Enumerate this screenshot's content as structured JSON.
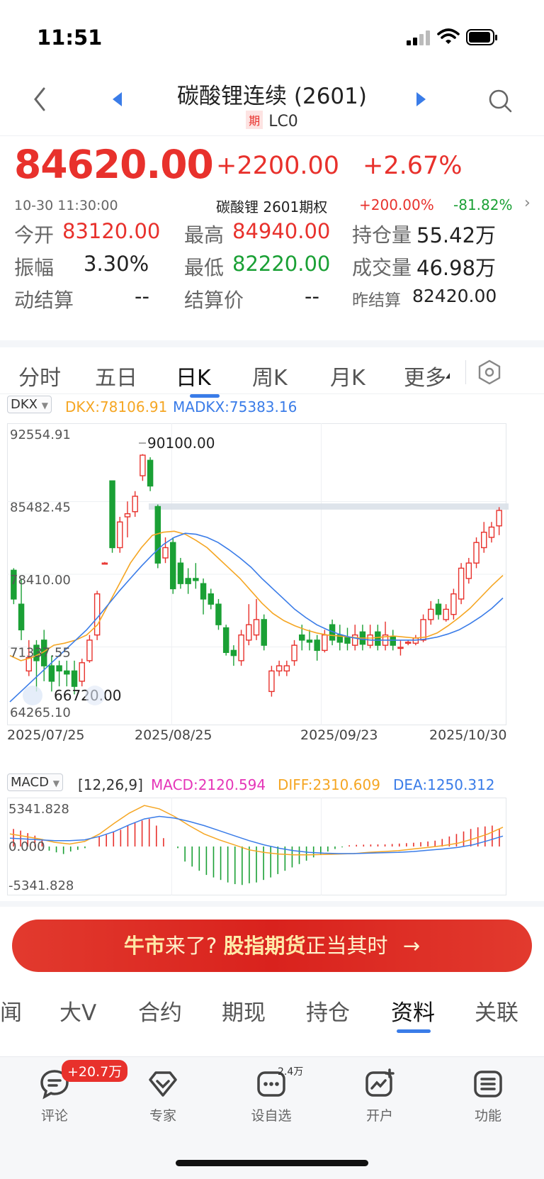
{
  "status_bar": {
    "time": "11:51"
  },
  "header": {
    "title": "碳酸锂连续 (2601)",
    "tag": "期",
    "code": "LC0"
  },
  "quote": {
    "price": "84620.00",
    "change": "+2200.00",
    "change_pct": "+2.67%",
    "timestamp": "10-30 11:30:00",
    "option_name": "碳酸锂 2601期权",
    "option_pct1": "+200.00%",
    "option_pct2": "-81.82%"
  },
  "stats": [
    {
      "label": "今开",
      "value": "83120.00",
      "color": "red"
    },
    {
      "label": "最高",
      "value": "84940.00",
      "color": "red"
    },
    {
      "label": "持仓量",
      "value": "55.42万",
      "color": "dark"
    },
    {
      "label": "振幅",
      "value": "3.30%",
      "color": "dark"
    },
    {
      "label": "最低",
      "value": "82220.00",
      "color": "green"
    },
    {
      "label": "成交量",
      "value": "46.98万",
      "color": "dark"
    },
    {
      "label": "动结算",
      "value": "--",
      "color": "dark"
    },
    {
      "label": "结算价",
      "value": "--",
      "color": "dark"
    },
    {
      "label": "昨结算",
      "value": "82420.00",
      "color": "dark"
    }
  ],
  "kline_tabs": [
    "分时",
    "五日",
    "日K",
    "周K",
    "月K",
    "更多"
  ],
  "kline_active": 2,
  "indicator": {
    "name": "DKX",
    "dkx": "DKX:78106.91",
    "madkx": "MADKX:75383.16"
  },
  "macd": {
    "name": "MACD",
    "params": "[12,26,9]",
    "macd": "MACD:2120.594",
    "diff": "DIFF:2310.609",
    "dea": "DEA:1250.312"
  },
  "colors": {
    "up": "#e8312c",
    "down": "#1aa035",
    "dkx": "#f5a623",
    "madkx": "#3a7ce8",
    "macd": "#e535b8",
    "accent": "#3a7ce8"
  },
  "chart_data": [
    {
      "type": "candlestick",
      "y_ticks": [
        "92554.91",
        "85482.45",
        "78410.00",
        "71337.55",
        "64265.10"
      ],
      "ylim": [
        64265.1,
        92554.91
      ],
      "x_labels": [
        "2025/07/25",
        "2025/08/25",
        "2025/09/23",
        "2025/10/30"
      ],
      "annotations": {
        "max_label": "90100.00",
        "min_label": "66720.00"
      },
      "series": [
        {
          "name": "DKX",
          "values": [
            70500,
            70000,
            70300,
            70800,
            71500,
            71700,
            72000,
            72500,
            73500,
            75500,
            77500,
            79500,
            81000,
            82200,
            82500,
            82600,
            82300,
            81700,
            81000,
            80000,
            79000,
            78000,
            76800,
            75600,
            74600,
            73900,
            73400,
            73000,
            72700,
            72500,
            72400,
            72300,
            72200,
            72200,
            72300,
            72400,
            72300,
            72200,
            72300,
            72700,
            73400,
            74200,
            75100,
            76200,
            77300,
            78300
          ]
        },
        {
          "name": "MADKX",
          "values": [
            66000,
            67000,
            68000,
            69000,
            70000,
            71000,
            72000,
            73000,
            74200,
            75500,
            76800,
            78000,
            79200,
            80300,
            81300,
            82000,
            82400,
            82300,
            82000,
            81500,
            80800,
            80000,
            79100,
            78000,
            77000,
            76000,
            75000,
            74200,
            73500,
            73000,
            72600,
            72300,
            72100,
            72000,
            72000,
            72000,
            72000,
            72000,
            72100,
            72300,
            72600,
            73000,
            73600,
            74300,
            75100,
            76100
          ]
        }
      ],
      "candles": [
        {
          "o": 78800,
          "c": 76000,
          "h": 79000,
          "l": 75500
        },
        {
          "o": 75500,
          "c": 73000,
          "h": 78000,
          "l": 72000
        },
        {
          "o": 69000,
          "c": 70300,
          "h": 72000,
          "l": 68500
        },
        {
          "o": 71500,
          "c": 70000,
          "h": 72000,
          "l": 67000
        },
        {
          "o": 72000,
          "c": 69500,
          "h": 73000,
          "l": 68000
        },
        {
          "o": 69500,
          "c": 68000,
          "h": 70500,
          "l": 67000
        },
        {
          "o": 69500,
          "c": 69000,
          "h": 70000,
          "l": 67500
        },
        {
          "o": 69000,
          "c": 68700,
          "h": 70000,
          "l": 67500
        },
        {
          "o": 69000,
          "c": 67500,
          "h": 70000,
          "l": 66720
        },
        {
          "o": 68000,
          "c": 69800,
          "h": 70200,
          "l": 67500
        },
        {
          "o": 70000,
          "c": 72000,
          "h": 72500,
          "l": 69800
        },
        {
          "o": 72500,
          "c": 76500,
          "h": 76800,
          "l": 72000
        },
        {
          "o": 79500,
          "c": 79500,
          "h": 79600,
          "l": 79400
        },
        {
          "o": 87500,
          "c": 81000,
          "h": 87500,
          "l": 80500
        },
        {
          "o": 81000,
          "c": 83500,
          "h": 84000,
          "l": 80500
        },
        {
          "o": 84000,
          "c": 84300,
          "h": 85500,
          "l": 82000
        },
        {
          "o": 84500,
          "c": 86000,
          "h": 86500,
          "l": 84000
        },
        {
          "o": 88000,
          "c": 90000,
          "h": 90100,
          "l": 87500
        },
        {
          "o": 89500,
          "c": 87000,
          "h": 89800,
          "l": 86500
        },
        {
          "o": 85000,
          "c": 79500,
          "h": 85200,
          "l": 79000
        },
        {
          "o": 80000,
          "c": 81000,
          "h": 82000,
          "l": 79500
        },
        {
          "o": 81500,
          "c": 77000,
          "h": 82000,
          "l": 76500
        },
        {
          "o": 79500,
          "c": 77500,
          "h": 80000,
          "l": 77000
        },
        {
          "o": 78000,
          "c": 77500,
          "h": 79000,
          "l": 76500
        },
        {
          "o": 78000,
          "c": 77800,
          "h": 79500,
          "l": 77000
        },
        {
          "o": 77500,
          "c": 76000,
          "h": 78000,
          "l": 74500
        },
        {
          "o": 76500,
          "c": 75500,
          "h": 77000,
          "l": 75000
        },
        {
          "o": 75500,
          "c": 73500,
          "h": 76000,
          "l": 73000
        },
        {
          "o": 73200,
          "c": 70800,
          "h": 73500,
          "l": 70500
        },
        {
          "o": 71000,
          "c": 70500,
          "h": 71500,
          "l": 69500
        },
        {
          "o": 70000,
          "c": 72500,
          "h": 73000,
          "l": 69500
        },
        {
          "o": 72000,
          "c": 73500,
          "h": 75500,
          "l": 71500
        },
        {
          "o": 72500,
          "c": 74000,
          "h": 76000,
          "l": 72000
        },
        {
          "o": 74000,
          "c": 71500,
          "h": 74500,
          "l": 71000
        },
        {
          "o": 67000,
          "c": 69000,
          "h": 69500,
          "l": 66500
        },
        {
          "o": 69000,
          "c": 69500,
          "h": 70000,
          "l": 68500
        },
        {
          "o": 69000,
          "c": 69500,
          "h": 70000,
          "l": 68500
        },
        {
          "o": 70000,
          "c": 71500,
          "h": 72000,
          "l": 69500
        },
        {
          "o": 72500,
          "c": 72000,
          "h": 73500,
          "l": 71000
        },
        {
          "o": 72000,
          "c": 71800,
          "h": 73000,
          "l": 71000
        },
        {
          "o": 72000,
          "c": 71000,
          "h": 72500,
          "l": 70000
        },
        {
          "o": 71000,
          "c": 72500,
          "h": 73000,
          "l": 70800
        },
        {
          "o": 73500,
          "c": 72000,
          "h": 74000,
          "l": 71500
        },
        {
          "o": 72500,
          "c": 71800,
          "h": 73500,
          "l": 71000
        },
        {
          "o": 72300,
          "c": 71700,
          "h": 73200,
          "l": 71000
        },
        {
          "o": 71500,
          "c": 72500,
          "h": 73500,
          "l": 71000
        },
        {
          "o": 72800,
          "c": 71600,
          "h": 73500,
          "l": 71000
        },
        {
          "o": 71500,
          "c": 72500,
          "h": 73500,
          "l": 71200
        },
        {
          "o": 72800,
          "c": 71500,
          "h": 73500,
          "l": 71000
        },
        {
          "o": 71500,
          "c": 72500,
          "h": 73800,
          "l": 71000
        },
        {
          "o": 72300,
          "c": 71500,
          "h": 73000,
          "l": 71000
        },
        {
          "o": 71300,
          "c": 71300,
          "h": 72000,
          "l": 70500
        },
        {
          "o": 71800,
          "c": 71800,
          "h": 72000,
          "l": 71500
        },
        {
          "o": 71700,
          "c": 72200,
          "h": 72500,
          "l": 71500
        },
        {
          "o": 72000,
          "c": 74000,
          "h": 74500,
          "l": 71800
        },
        {
          "o": 74000,
          "c": 75000,
          "h": 75800,
          "l": 73500
        },
        {
          "o": 75500,
          "c": 74500,
          "h": 76000,
          "l": 74000
        },
        {
          "o": 74000,
          "c": 75000,
          "h": 75500,
          "l": 73800
        },
        {
          "o": 74500,
          "c": 76500,
          "h": 77000,
          "l": 74000
        },
        {
          "o": 76000,
          "c": 79000,
          "h": 79500,
          "l": 75500
        },
        {
          "o": 78000,
          "c": 79500,
          "h": 80000,
          "l": 77500
        },
        {
          "o": 79500,
          "c": 81500,
          "h": 82000,
          "l": 79000
        },
        {
          "o": 81000,
          "c": 82500,
          "h": 83500,
          "l": 80500
        },
        {
          "o": 82000,
          "c": 83000,
          "h": 83500,
          "l": 81500
        },
        {
          "o": 83120,
          "c": 84620,
          "h": 84940,
          "l": 82220
        }
      ],
      "highlight_band": [
        84700,
        85300
      ]
    },
    {
      "type": "bar",
      "name": "MACD",
      "y_ticks": [
        "5341.828",
        "0.000",
        "-5341.828"
      ],
      "ylim": [
        -5341.828,
        5341.828
      ],
      "values": [
        2100,
        1900,
        1600,
        1300,
        900,
        -500,
        -700,
        -900,
        -600,
        -400,
        -200,
        0,
        1200,
        1400,
        1700,
        2000,
        2500,
        2900,
        3100,
        3300,
        2500,
        1000,
        0,
        -200,
        -1800,
        -2400,
        -2900,
        -3400,
        -3700,
        -4000,
        -4300,
        -4500,
        -4600,
        -4400,
        -4300,
        -4000,
        -3700,
        -3300,
        -2900,
        -2500,
        -2100,
        -1700,
        -1300,
        -900,
        -600,
        -300,
        -100,
        150,
        200,
        220,
        240,
        250,
        250,
        300,
        350,
        400,
        450,
        520,
        600,
        700,
        900,
        1200,
        1500,
        1800,
        2100,
        2300,
        2400,
        2500,
        2120
      ],
      "series": [
        {
          "name": "DIFF",
          "values": [
            1500,
            1200,
            900,
            500,
            300,
            600,
            1500,
            2800,
            4000,
            4900,
            4500,
            3600,
            2500,
            1500,
            800,
            200,
            -400,
            -700,
            -900,
            -1000,
            -1000,
            -950,
            -900,
            -850,
            -700,
            -600,
            -500,
            -300,
            -100,
            100,
            400,
            900,
            1500,
            2310
          ]
        },
        {
          "name": "DEA",
          "values": [
            1000,
            900,
            800,
            700,
            700,
            800,
            1200,
            1800,
            2600,
            3300,
            3600,
            3400,
            3000,
            2500,
            1900,
            1300,
            700,
            200,
            -200,
            -500,
            -700,
            -800,
            -850,
            -850,
            -800,
            -750,
            -700,
            -600,
            -450,
            -300,
            -100,
            200,
            700,
            1250
          ]
        }
      ]
    }
  ],
  "banner": {
    "part1": "牛市",
    "part2": "来了? ",
    "part3": "股指期货",
    "part4": "正当其时",
    "arrow": "→"
  },
  "section_tabs": [
    "闻",
    "大V",
    "合约",
    "期现",
    "持仓",
    "资料",
    "关联"
  ],
  "section_active": 5,
  "bottom_bar": {
    "items": [
      "评论",
      "专家",
      "设自选",
      "开户",
      "功能"
    ],
    "comment_badge": "+20.7万",
    "watch_badge": "2.4万"
  }
}
